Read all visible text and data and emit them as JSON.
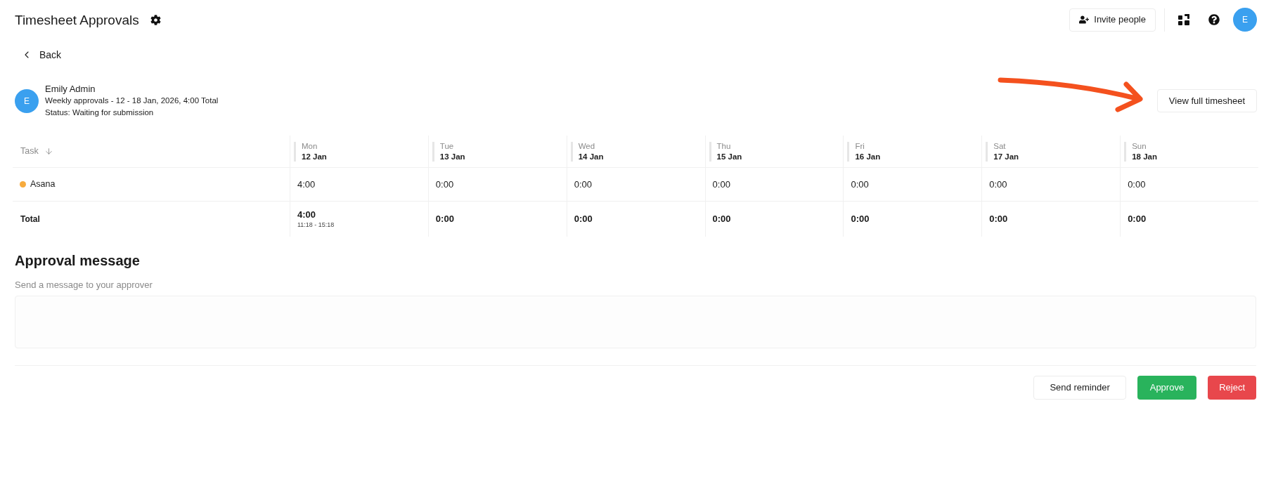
{
  "top_bar": {
    "title": "Timesheet Approvals",
    "invite_button": "Invite people",
    "avatar_initial": "E"
  },
  "back_link": "Back",
  "employee": {
    "avatar_initial": "E",
    "name": "Emily Admin",
    "summary": "Weekly approvals - 12 - 18 Jan, 2026, 4:00 Total",
    "status": "Status: Waiting for submission"
  },
  "view_button": "View full timesheet",
  "table": {
    "task_header": "Task",
    "columns": [
      {
        "day": "Mon",
        "date": "12 Jan"
      },
      {
        "day": "Tue",
        "date": "13 Jan"
      },
      {
        "day": "Wed",
        "date": "14 Jan"
      },
      {
        "day": "Thu",
        "date": "15 Jan"
      },
      {
        "day": "Fri",
        "date": "16 Jan"
      },
      {
        "day": "Sat",
        "date": "17 Jan"
      },
      {
        "day": "Sun",
        "date": "18 Jan"
      }
    ],
    "rows": [
      {
        "task": "Asana",
        "color": "#f7ab3d",
        "cells": [
          "4:00",
          "0:00",
          "0:00",
          "0:00",
          "0:00",
          "0:00",
          "0:00"
        ]
      }
    ],
    "total": {
      "label": "Total",
      "cells": [
        {
          "value": "4:00",
          "range": "11:18 - 15:18"
        },
        {
          "value": "0:00"
        },
        {
          "value": "0:00"
        },
        {
          "value": "0:00"
        },
        {
          "value": "0:00"
        },
        {
          "value": "0:00"
        },
        {
          "value": "0:00"
        }
      ]
    }
  },
  "approval": {
    "title": "Approval message",
    "hint": "Send a message to your approver"
  },
  "actions": [
    {
      "label": "Send reminder",
      "kind": "secondary"
    },
    {
      "label": "Approve",
      "kind": "approve"
    },
    {
      "label": "Reject",
      "kind": "reject"
    }
  ]
}
